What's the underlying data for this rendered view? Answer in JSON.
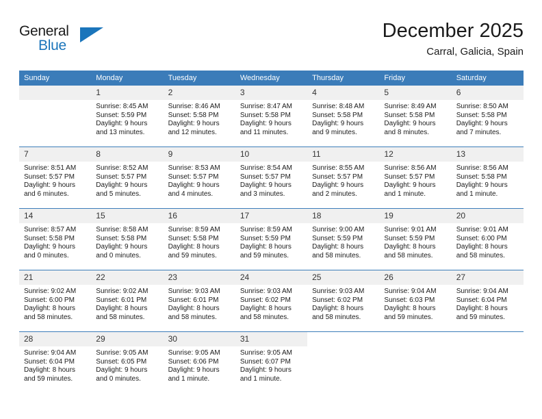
{
  "brand": {
    "name_top": "General",
    "name_bottom": "Blue",
    "accent_color": "#1b75bb"
  },
  "header": {
    "month_title": "December 2025",
    "location": "Carral, Galicia, Spain"
  },
  "calendar": {
    "header_color": "#3b7cb9",
    "weekday_headers": [
      "Sunday",
      "Monday",
      "Tuesday",
      "Wednesday",
      "Thursday",
      "Friday",
      "Saturday"
    ],
    "weeks": [
      [
        {
          "day": "",
          "sunrise": "",
          "sunset": "",
          "daylight": ""
        },
        {
          "day": "1",
          "sunrise": "Sunrise: 8:45 AM",
          "sunset": "Sunset: 5:59 PM",
          "daylight": "Daylight: 9 hours and 13 minutes."
        },
        {
          "day": "2",
          "sunrise": "Sunrise: 8:46 AM",
          "sunset": "Sunset: 5:58 PM",
          "daylight": "Daylight: 9 hours and 12 minutes."
        },
        {
          "day": "3",
          "sunrise": "Sunrise: 8:47 AM",
          "sunset": "Sunset: 5:58 PM",
          "daylight": "Daylight: 9 hours and 11 minutes."
        },
        {
          "day": "4",
          "sunrise": "Sunrise: 8:48 AM",
          "sunset": "Sunset: 5:58 PM",
          "daylight": "Daylight: 9 hours and 9 minutes."
        },
        {
          "day": "5",
          "sunrise": "Sunrise: 8:49 AM",
          "sunset": "Sunset: 5:58 PM",
          "daylight": "Daylight: 9 hours and 8 minutes."
        },
        {
          "day": "6",
          "sunrise": "Sunrise: 8:50 AM",
          "sunset": "Sunset: 5:58 PM",
          "daylight": "Daylight: 9 hours and 7 minutes."
        }
      ],
      [
        {
          "day": "7",
          "sunrise": "Sunrise: 8:51 AM",
          "sunset": "Sunset: 5:57 PM",
          "daylight": "Daylight: 9 hours and 6 minutes."
        },
        {
          "day": "8",
          "sunrise": "Sunrise: 8:52 AM",
          "sunset": "Sunset: 5:57 PM",
          "daylight": "Daylight: 9 hours and 5 minutes."
        },
        {
          "day": "9",
          "sunrise": "Sunrise: 8:53 AM",
          "sunset": "Sunset: 5:57 PM",
          "daylight": "Daylight: 9 hours and 4 minutes."
        },
        {
          "day": "10",
          "sunrise": "Sunrise: 8:54 AM",
          "sunset": "Sunset: 5:57 PM",
          "daylight": "Daylight: 9 hours and 3 minutes."
        },
        {
          "day": "11",
          "sunrise": "Sunrise: 8:55 AM",
          "sunset": "Sunset: 5:57 PM",
          "daylight": "Daylight: 9 hours and 2 minutes."
        },
        {
          "day": "12",
          "sunrise": "Sunrise: 8:56 AM",
          "sunset": "Sunset: 5:57 PM",
          "daylight": "Daylight: 9 hours and 1 minute."
        },
        {
          "day": "13",
          "sunrise": "Sunrise: 8:56 AM",
          "sunset": "Sunset: 5:58 PM",
          "daylight": "Daylight: 9 hours and 1 minute."
        }
      ],
      [
        {
          "day": "14",
          "sunrise": "Sunrise: 8:57 AM",
          "sunset": "Sunset: 5:58 PM",
          "daylight": "Daylight: 9 hours and 0 minutes."
        },
        {
          "day": "15",
          "sunrise": "Sunrise: 8:58 AM",
          "sunset": "Sunset: 5:58 PM",
          "daylight": "Daylight: 9 hours and 0 minutes."
        },
        {
          "day": "16",
          "sunrise": "Sunrise: 8:59 AM",
          "sunset": "Sunset: 5:58 PM",
          "daylight": "Daylight: 8 hours and 59 minutes."
        },
        {
          "day": "17",
          "sunrise": "Sunrise: 8:59 AM",
          "sunset": "Sunset: 5:59 PM",
          "daylight": "Daylight: 8 hours and 59 minutes."
        },
        {
          "day": "18",
          "sunrise": "Sunrise: 9:00 AM",
          "sunset": "Sunset: 5:59 PM",
          "daylight": "Daylight: 8 hours and 58 minutes."
        },
        {
          "day": "19",
          "sunrise": "Sunrise: 9:01 AM",
          "sunset": "Sunset: 5:59 PM",
          "daylight": "Daylight: 8 hours and 58 minutes."
        },
        {
          "day": "20",
          "sunrise": "Sunrise: 9:01 AM",
          "sunset": "Sunset: 6:00 PM",
          "daylight": "Daylight: 8 hours and 58 minutes."
        }
      ],
      [
        {
          "day": "21",
          "sunrise": "Sunrise: 9:02 AM",
          "sunset": "Sunset: 6:00 PM",
          "daylight": "Daylight: 8 hours and 58 minutes."
        },
        {
          "day": "22",
          "sunrise": "Sunrise: 9:02 AM",
          "sunset": "Sunset: 6:01 PM",
          "daylight": "Daylight: 8 hours and 58 minutes."
        },
        {
          "day": "23",
          "sunrise": "Sunrise: 9:03 AM",
          "sunset": "Sunset: 6:01 PM",
          "daylight": "Daylight: 8 hours and 58 minutes."
        },
        {
          "day": "24",
          "sunrise": "Sunrise: 9:03 AM",
          "sunset": "Sunset: 6:02 PM",
          "daylight": "Daylight: 8 hours and 58 minutes."
        },
        {
          "day": "25",
          "sunrise": "Sunrise: 9:03 AM",
          "sunset": "Sunset: 6:02 PM",
          "daylight": "Daylight: 8 hours and 58 minutes."
        },
        {
          "day": "26",
          "sunrise": "Sunrise: 9:04 AM",
          "sunset": "Sunset: 6:03 PM",
          "daylight": "Daylight: 8 hours and 59 minutes."
        },
        {
          "day": "27",
          "sunrise": "Sunrise: 9:04 AM",
          "sunset": "Sunset: 6:04 PM",
          "daylight": "Daylight: 8 hours and 59 minutes."
        }
      ],
      [
        {
          "day": "28",
          "sunrise": "Sunrise: 9:04 AM",
          "sunset": "Sunset: 6:04 PM",
          "daylight": "Daylight: 8 hours and 59 minutes."
        },
        {
          "day": "29",
          "sunrise": "Sunrise: 9:05 AM",
          "sunset": "Sunset: 6:05 PM",
          "daylight": "Daylight: 9 hours and 0 minutes."
        },
        {
          "day": "30",
          "sunrise": "Sunrise: 9:05 AM",
          "sunset": "Sunset: 6:06 PM",
          "daylight": "Daylight: 9 hours and 1 minute."
        },
        {
          "day": "31",
          "sunrise": "Sunrise: 9:05 AM",
          "sunset": "Sunset: 6:07 PM",
          "daylight": "Daylight: 9 hours and 1 minute."
        },
        {
          "day": "",
          "sunrise": "",
          "sunset": "",
          "daylight": ""
        },
        {
          "day": "",
          "sunrise": "",
          "sunset": "",
          "daylight": ""
        },
        {
          "day": "",
          "sunrise": "",
          "sunset": "",
          "daylight": ""
        }
      ]
    ]
  }
}
